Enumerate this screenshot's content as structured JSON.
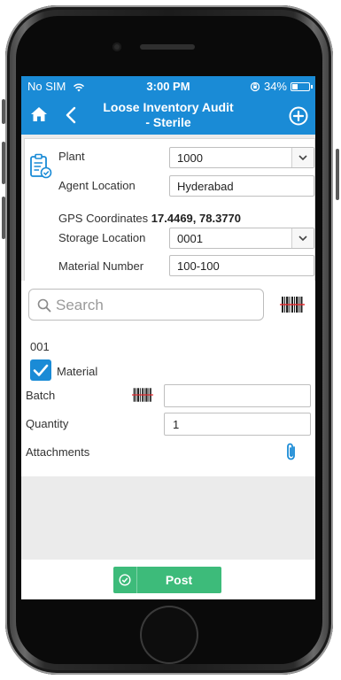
{
  "status_bar": {
    "carrier": "No SIM",
    "time": "3:00 PM",
    "battery_percent": "34%",
    "battery_level": 0.34
  },
  "nav": {
    "title_line1": "Loose Inventory Audit",
    "title_line2": "- Sterile"
  },
  "header": {
    "plant_label": "Plant",
    "plant_value": "1000",
    "agent_location_label": "Agent Location",
    "agent_location_value": "Hyderabad",
    "gps_label": "GPS Coordinates",
    "gps_value": "17.4469, 78.3770",
    "storage_location_label": "Storage Location",
    "storage_location_value": "0001",
    "material_number_label": "Material Number",
    "material_number_value": "100-100"
  },
  "search": {
    "placeholder": "Search"
  },
  "item": {
    "number": "001",
    "material_label": "Material",
    "batch_label": "Batch",
    "batch_value": "",
    "quantity_label": "Quantity",
    "quantity_value": "1",
    "attachments_label": "Attachments"
  },
  "footer": {
    "post_label": "Post"
  },
  "colors": {
    "brand_blue": "#1a8bd6",
    "post_green": "#3dbb7a"
  },
  "icons": [
    "home-icon",
    "back-icon",
    "add-circle-icon",
    "clipboard-icon",
    "search-icon",
    "barcode-icon",
    "checkbox-icon",
    "paperclip-icon",
    "check-circle-icon"
  ]
}
